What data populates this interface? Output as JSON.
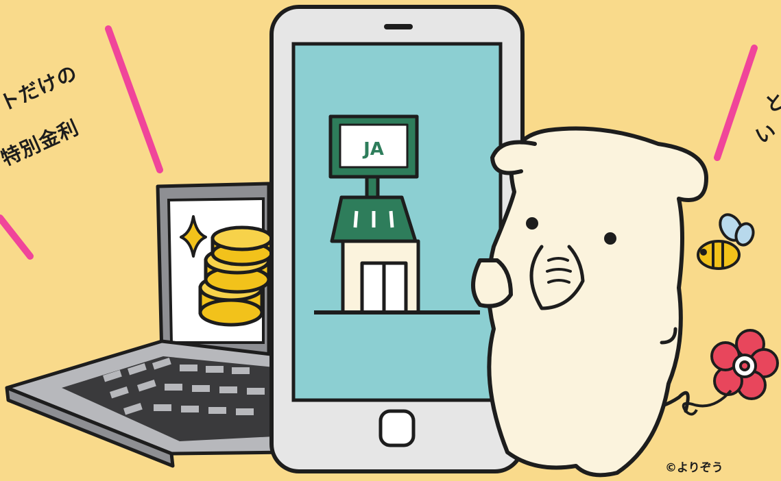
{
  "captions": {
    "left_line1": "トだけの",
    "left_line2": "特別金利",
    "right_line1": "と",
    "right_line2": "い"
  },
  "logo_text": "JA",
  "copyright": "©よりぞう",
  "colors": {
    "background": "#f9da8b",
    "accent_pink": "#f0459a",
    "phone_screen": "#8ccfd2",
    "store_green": "#2e7d5b",
    "coin_gold": "#f2c21b",
    "character_cream": "#fbf3dd",
    "flower_red": "#e8465c"
  }
}
